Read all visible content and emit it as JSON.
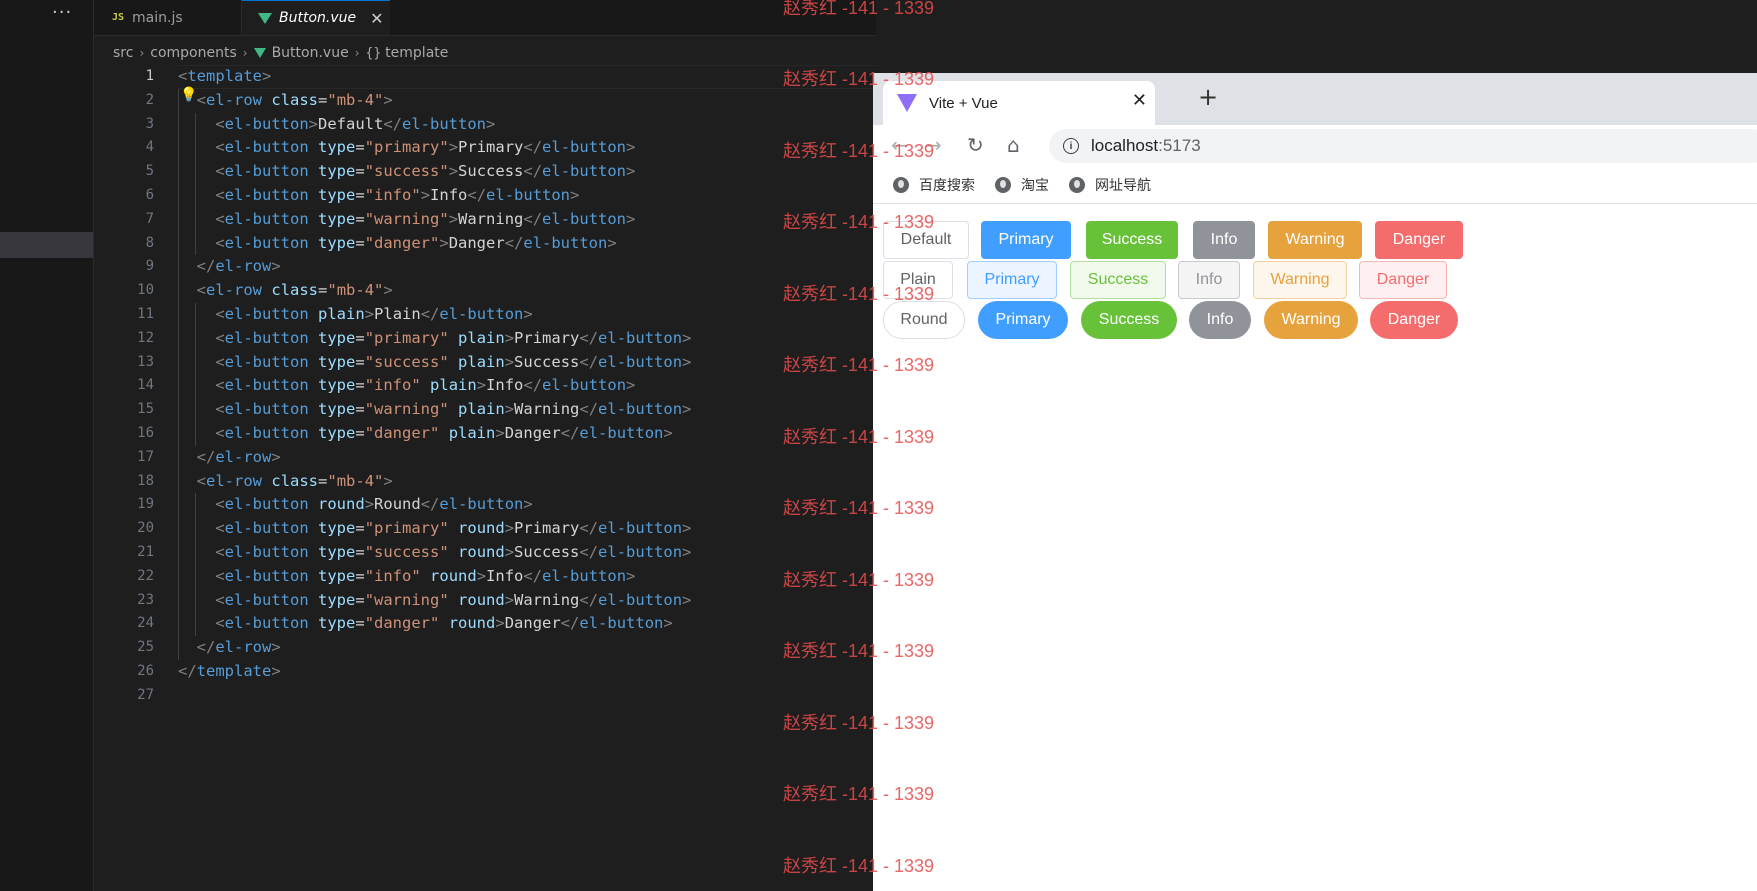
{
  "sidebar": {
    "more_label": "···"
  },
  "tabs": [
    {
      "icon": "JS",
      "label": "main.js"
    },
    {
      "icon": "vue-icon",
      "label": "Button.vue",
      "close": "✕"
    }
  ],
  "breadcrumb": [
    "src",
    "components",
    "Button.vue",
    "template"
  ],
  "editor": {
    "line_numbers": [
      "1",
      "2",
      "3",
      "4",
      "5",
      "6",
      "7",
      "8",
      "9",
      "10",
      "11",
      "12",
      "13",
      "14",
      "15",
      "16",
      "17",
      "18",
      "19",
      "20",
      "21",
      "22",
      "23",
      "24",
      "25",
      "26",
      "27"
    ],
    "active_line": "1",
    "lines": [
      "<template>",
      "  <el-row class=\"mb-4\">",
      "    <el-button>Default</el-button>",
      "    <el-button type=\"primary\">Primary</el-button>",
      "    <el-button type=\"success\">Success</el-button>",
      "    <el-button type=\"info\">Info</el-button>",
      "    <el-button type=\"warning\">Warning</el-button>",
      "    <el-button type=\"danger\">Danger</el-button>",
      "  </el-row>",
      "  <el-row class=\"mb-4\">",
      "    <el-button plain>Plain</el-button>",
      "    <el-button type=\"primary\" plain>Primary</el-button>",
      "    <el-button type=\"success\" plain>Success</el-button>",
      "    <el-button type=\"info\" plain>Info</el-button>",
      "    <el-button type=\"warning\" plain>Warning</el-button>",
      "    <el-button type=\"danger\" plain>Danger</el-button>",
      "  </el-row>",
      "  <el-row class=\"mb-4\">",
      "    <el-button round>Round</el-button>",
      "    <el-button type=\"primary\" round>Primary</el-button>",
      "    <el-button type=\"success\" round>Success</el-button>",
      "    <el-button type=\"info\" round>Info</el-button>",
      "    <el-button type=\"warning\" round>Warning</el-button>",
      "    <el-button type=\"danger\" round>Danger</el-button>",
      "  </el-row>",
      "</template>",
      ""
    ],
    "colors": {
      "tag": "#569cd6",
      "attr": "#9cdcfe",
      "string": "#ce9178",
      "text": "#d4d4d4",
      "bracket": "#808080"
    }
  },
  "browser": {
    "tab_title": "Vite + Vue",
    "tab_close": "✕",
    "new_tab": "+",
    "nav": {
      "back": "←",
      "forward": "→",
      "reload": "↻",
      "home": "⌂"
    },
    "url_host": "localhost",
    "url_port": ":5173",
    "info_icon": "i",
    "bookmarks": [
      "百度搜索",
      "淘宝",
      "网址导航"
    ],
    "button_rows": [
      {
        "style": "default",
        "buttons": [
          {
            "label": "Default",
            "type": "default"
          },
          {
            "label": "Primary",
            "type": "primary"
          },
          {
            "label": "Success",
            "type": "success"
          },
          {
            "label": "Info",
            "type": "info"
          },
          {
            "label": "Warning",
            "type": "warning"
          },
          {
            "label": "Danger",
            "type": "danger"
          }
        ]
      },
      {
        "style": "plain",
        "buttons": [
          {
            "label": "Plain",
            "type": "default"
          },
          {
            "label": "Primary",
            "type": "primary"
          },
          {
            "label": "Success",
            "type": "success"
          },
          {
            "label": "Info",
            "type": "info"
          },
          {
            "label": "Warning",
            "type": "warning"
          },
          {
            "label": "Danger",
            "type": "danger"
          }
        ]
      },
      {
        "style": "round",
        "buttons": [
          {
            "label": "Round",
            "type": "default"
          },
          {
            "label": "Primary",
            "type": "primary"
          },
          {
            "label": "Success",
            "type": "success"
          },
          {
            "label": "Info",
            "type": "info"
          },
          {
            "label": "Warning",
            "type": "warning"
          },
          {
            "label": "Danger",
            "type": "danger"
          }
        ]
      }
    ],
    "type_colors": {
      "default": "#606266",
      "primary": "#409eff",
      "success": "#67c23a",
      "info": "#909399",
      "warning": "#e6a23c",
      "danger": "#f56c6c"
    },
    "plain_colors": {
      "primary": {
        "bg": "#ecf5ff",
        "border": "#a0cfff"
      },
      "success": {
        "bg": "#f0f9eb",
        "border": "#b3e19d"
      },
      "info": {
        "bg": "#f4f4f5",
        "border": "#c8c9cc"
      },
      "warning": {
        "bg": "#fdf6ec",
        "border": "#f3d19e"
      },
      "danger": {
        "bg": "#fef0f0",
        "border": "#fab6b6"
      }
    }
  },
  "watermark": "赵秀红 -141 - 1339"
}
